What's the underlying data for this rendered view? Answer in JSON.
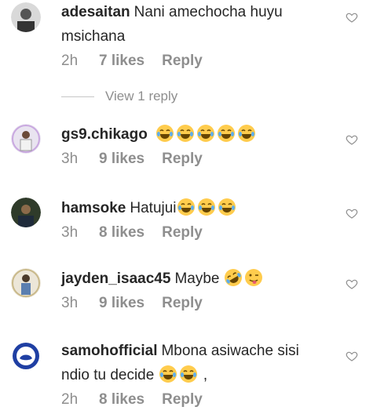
{
  "comments": [
    {
      "username": "adesaitan",
      "text_lines": [
        "Nani amechocha huyu",
        "msichana"
      ],
      "emojis": [],
      "tail": "",
      "time": "2h",
      "likes": "7 likes",
      "reply": "Reply",
      "avatar_icon": "avatar-icon"
    },
    {
      "username": "gs9.chikago",
      "text_lines": [
        ""
      ],
      "emojis": [
        "tears-of-joy",
        "tears-of-joy",
        "tears-of-joy",
        "tears-of-joy",
        "tears-of-joy"
      ],
      "tail": "",
      "time": "3h",
      "likes": "9 likes",
      "reply": "Reply",
      "avatar_icon": "avatar-icon"
    },
    {
      "username": "hamsoke",
      "text_lines": [
        "Hatujui"
      ],
      "emojis": [
        "tears-of-joy",
        "tears-of-joy",
        "tears-of-joy"
      ],
      "tail": "",
      "time": "3h",
      "likes": "8 likes",
      "reply": "Reply",
      "avatar_icon": "avatar-icon"
    },
    {
      "username": "jayden_isaac45",
      "text_lines": [
        "Maybe"
      ],
      "emojis": [
        "rolling-on-floor-laughing",
        "winking-face-with-tongue"
      ],
      "tail": "",
      "time": "3h",
      "likes": "9 likes",
      "reply": "Reply",
      "avatar_icon": "avatar-icon"
    },
    {
      "username": "samohofficial",
      "text_lines": [
        "Mbona asiwache sisi",
        "ndio tu decide"
      ],
      "emojis": [
        "tears-of-joy",
        "tears-of-joy"
      ],
      "tail": ",",
      "time": "2h",
      "likes": "8 likes",
      "reply": "Reply",
      "avatar_icon": "avatar-icon"
    }
  ],
  "view_replies": {
    "label": "View 1 reply"
  },
  "colors": {
    "text": "#262626",
    "muted": "#8e8e8e",
    "divider": "#c7c7c7",
    "emoji_yellow": "#ffcc4d"
  }
}
